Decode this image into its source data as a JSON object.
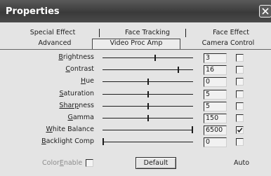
{
  "window": {
    "title": "Properties"
  },
  "tabs": {
    "row_back": [
      "Special Effect",
      "Face Tracking",
      "Face Effect"
    ],
    "row_front": [
      "Advanced",
      "Video Proc Amp",
      "Camera Control"
    ],
    "active": "Video Proc Amp"
  },
  "controls": [
    {
      "label_first": "B",
      "label_rest": "rightness",
      "value": "3",
      "level": 0.58,
      "auto": false
    },
    {
      "label_first": "C",
      "label_rest": "ontrast",
      "value": "16",
      "level": 0.84,
      "auto": false
    },
    {
      "label_first": "H",
      "label_rest": "ue",
      "value": "0",
      "level": 0.5,
      "auto": false
    },
    {
      "label_first": "S",
      "label_rest": "aturation",
      "value": "5",
      "level": 0.5,
      "auto": false
    },
    {
      "label_first": "Sharp",
      "label_rest": "ness",
      "value": "5",
      "level": 0.5,
      "auto": false
    },
    {
      "label_first": "G",
      "label_rest": "amma",
      "value": "150",
      "level": 0.5,
      "auto": false
    },
    {
      "label_first": "W",
      "label_rest": "hite Balance",
      "value": "6500",
      "level": 1.0,
      "auto": true
    },
    {
      "label_first": "B",
      "label_rest": "acklight Comp",
      "value": "0",
      "level": 0.0,
      "auto": false
    }
  ],
  "footer": {
    "color_enable_a": "Color",
    "color_enable_b": "E",
    "color_enable_c": "nable",
    "default_button": "Default",
    "auto_label": "Auto"
  }
}
